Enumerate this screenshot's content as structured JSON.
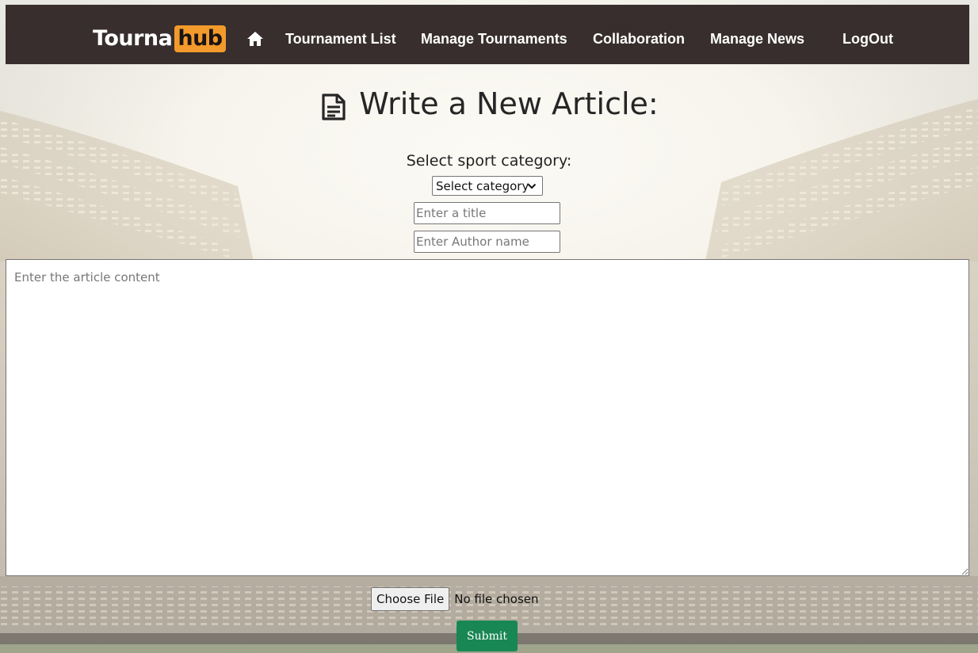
{
  "brand": {
    "logo_text_part1": "Tourna",
    "logo_text_part2": "hub",
    "accent_color": "#f39a2c",
    "navbar_color": "#372e2d"
  },
  "nav": {
    "home_icon": "home-icon",
    "items": [
      {
        "label": "Tournament List"
      },
      {
        "label": "Manage Tournaments"
      },
      {
        "label": "Collaboration"
      },
      {
        "label": "Manage News"
      },
      {
        "label": "LogOut"
      }
    ]
  },
  "page": {
    "heading_icon": "article-icon",
    "heading": "Write a New Article:"
  },
  "form": {
    "category_label": "Select sport category:",
    "category_selected": "Select category",
    "title_placeholder": "Enter a title",
    "author_placeholder": "Enter Author name",
    "content_placeholder": "Enter the article content",
    "file_button_label": "Choose File",
    "file_status": "No file chosen",
    "submit_label": "Submit",
    "submit_color": "#198754"
  }
}
